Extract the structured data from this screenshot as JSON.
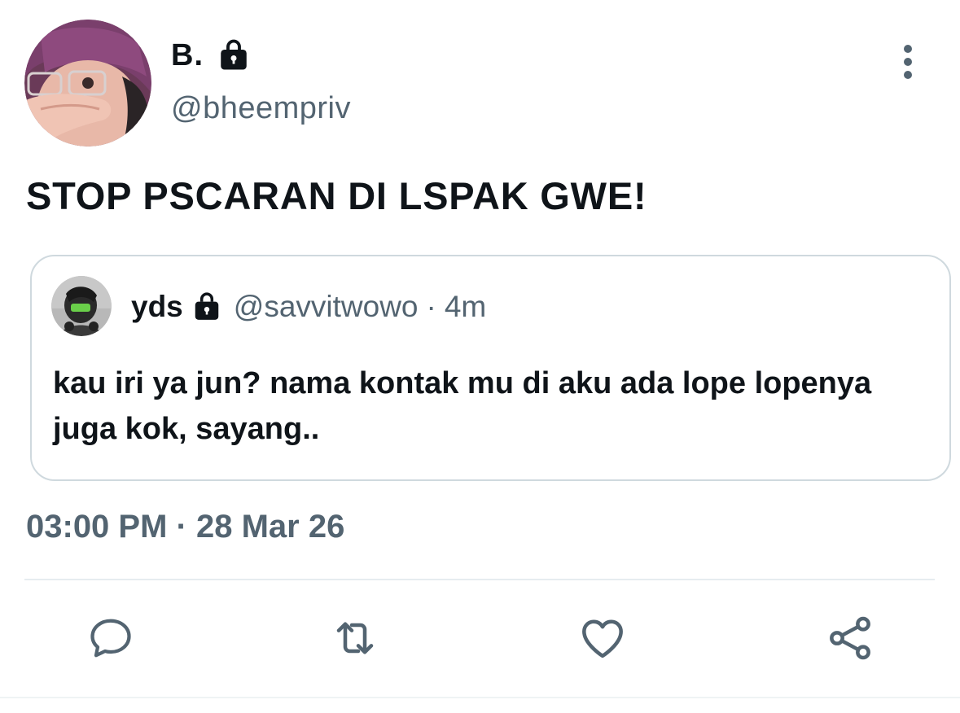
{
  "author": {
    "name": "B.",
    "handle": "@bheempriv",
    "avatar_icon": "avatar-photo",
    "protected_icon": "lock-icon"
  },
  "tweet": {
    "text": "STOP PSCARAN DI LSPAK GWE!",
    "timestamp": "03:00 PM · 28 Mar 26"
  },
  "quoted": {
    "name": "yds",
    "handle": "@savvitwowo",
    "separator": "·",
    "time": "4m",
    "text": "kau iri ya jun? nama kontak mu di aku ada lope lopenya juga kok, sayang..",
    "protected_icon": "lock-icon"
  },
  "actions": [
    {
      "name": "reply",
      "icon": "speech-bubble-icon"
    },
    {
      "name": "retweet",
      "icon": "retweet-icon"
    },
    {
      "name": "like",
      "icon": "heart-icon"
    },
    {
      "name": "share",
      "icon": "share-icon"
    }
  ],
  "colors": {
    "text_primary": "#0f1419",
    "text_secondary": "#536471",
    "border": "#cfd9de",
    "icon": "#536471"
  }
}
